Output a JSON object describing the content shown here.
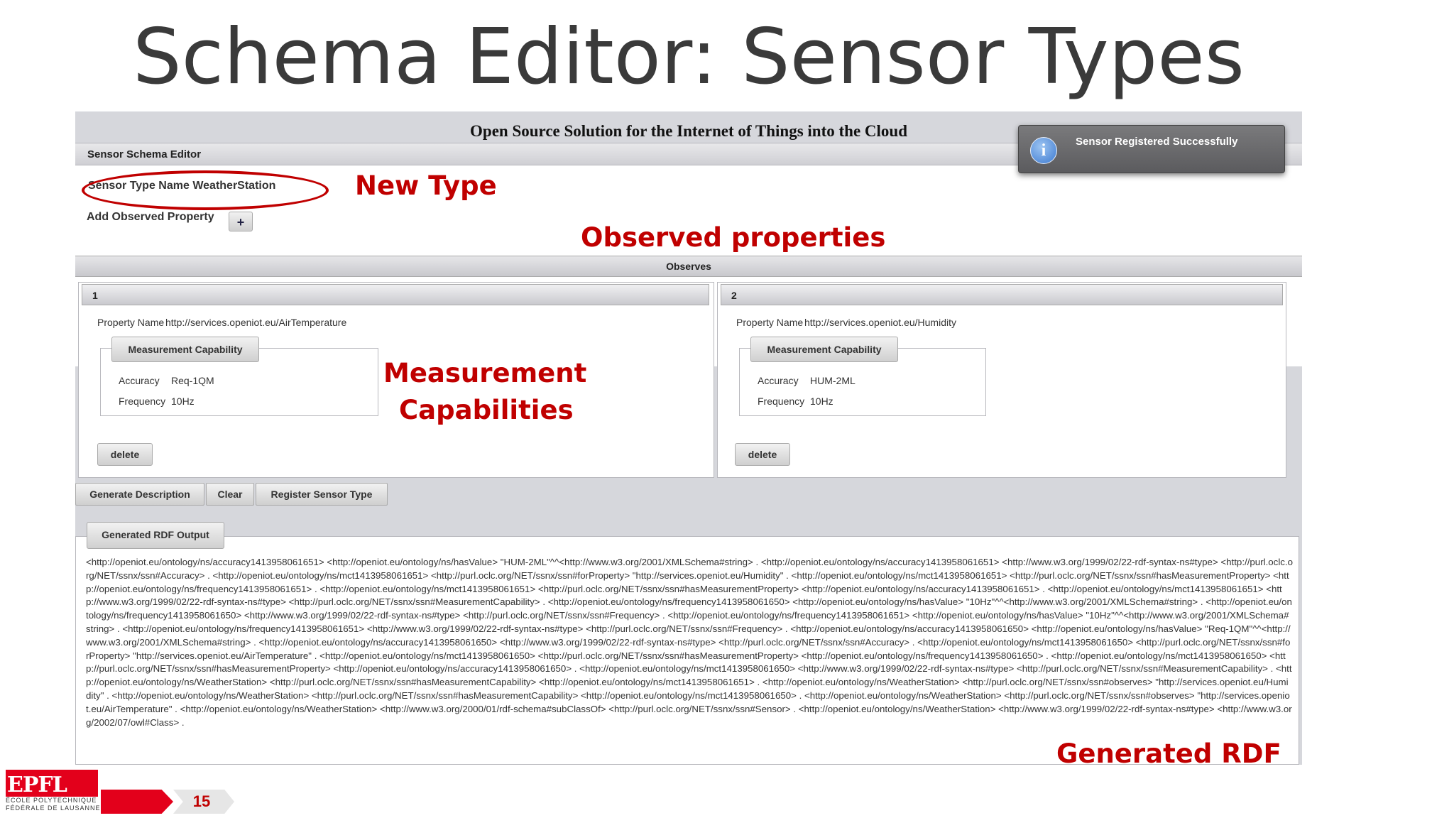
{
  "slide": {
    "title": "Schema Editor: Sensor Types",
    "page_number": "15"
  },
  "app": {
    "header": "Open Source Solution for the Internet of Things into the Cloud",
    "schema_editor": {
      "section_title": "Sensor Schema Editor",
      "type_name_label": "Sensor Type Name",
      "type_name_value": "WeatherStation",
      "add_property_label": "Add Observed Property",
      "add_button_glyph": "+"
    },
    "observes": {
      "title": "Observes",
      "properties": [
        {
          "index": "1",
          "property_name_label": "Property Name",
          "property_name_value": "http://services.openiot.eu/AirTemperature",
          "capability_title": "Measurement Capability",
          "accuracy_label": "Accuracy",
          "accuracy_value": "Req-1QM",
          "frequency_label": "Frequency",
          "frequency_value": "10Hz",
          "delete_label": "delete"
        },
        {
          "index": "2",
          "property_name_label": "Property Name",
          "property_name_value": "http://services.openiot.eu/Humidity",
          "capability_title": "Measurement Capability",
          "accuracy_label": "Accuracy",
          "accuracy_value": "HUM-2ML",
          "frequency_label": "Frequency",
          "frequency_value": "10Hz",
          "delete_label": "delete"
        }
      ]
    },
    "actions": {
      "generate_label": "Generate Description",
      "clear_label": "Clear",
      "register_label": "Register Sensor Type"
    },
    "rdf_output": {
      "title": "Generated RDF Output",
      "text": "<http://openiot.eu/ontology/ns/accuracy1413958061651> <http://openiot.eu/ontology/ns/hasValue> \"HUM-2ML\"^^<http://www.w3.org/2001/XMLSchema#string> . <http://openiot.eu/ontology/ns/accuracy1413958061651> <http://www.w3.org/1999/02/22-rdf-syntax-ns#type> <http://purl.oclc.org/NET/ssnx/ssn#Accuracy> . <http://openiot.eu/ontology/ns/mct1413958061651> <http://purl.oclc.org/NET/ssnx/ssn#forProperty> \"http://services.openiot.eu/Humidity\" . <http://openiot.eu/ontology/ns/mct1413958061651> <http://purl.oclc.org/NET/ssnx/ssn#hasMeasurementProperty> <http://openiot.eu/ontology/ns/frequency1413958061651> . <http://openiot.eu/ontology/ns/mct1413958061651> <http://purl.oclc.org/NET/ssnx/ssn#hasMeasurementProperty> <http://openiot.eu/ontology/ns/accuracy1413958061651> . <http://openiot.eu/ontology/ns/mct1413958061651> <http://www.w3.org/1999/02/22-rdf-syntax-ns#type> <http://purl.oclc.org/NET/ssnx/ssn#MeasurementCapability> . <http://openiot.eu/ontology/ns/frequency1413958061650> <http://openiot.eu/ontology/ns/hasValue> \"10Hz\"^^<http://www.w3.org/2001/XMLSchema#string> . <http://openiot.eu/ontology/ns/frequency1413958061650> <http://www.w3.org/1999/02/22-rdf-syntax-ns#type> <http://purl.oclc.org/NET/ssnx/ssn#Frequency> . <http://openiot.eu/ontology/ns/frequency1413958061651> <http://openiot.eu/ontology/ns/hasValue> \"10Hz\"^^<http://www.w3.org/2001/XMLSchema#string> . <http://openiot.eu/ontology/ns/frequency1413958061651> <http://www.w3.org/1999/02/22-rdf-syntax-ns#type> <http://purl.oclc.org/NET/ssnx/ssn#Frequency> . <http://openiot.eu/ontology/ns/accuracy1413958061650> <http://openiot.eu/ontology/ns/hasValue> \"Req-1QM\"^^<http://www.w3.org/2001/XMLSchema#string> . <http://openiot.eu/ontology/ns/accuracy1413958061650> <http://www.w3.org/1999/02/22-rdf-syntax-ns#type> <http://purl.oclc.org/NET/ssnx/ssn#Accuracy> . <http://openiot.eu/ontology/ns/mct1413958061650> <http://purl.oclc.org/NET/ssnx/ssn#forProperty> \"http://services.openiot.eu/AirTemperature\" . <http://openiot.eu/ontology/ns/mct1413958061650> <http://purl.oclc.org/NET/ssnx/ssn#hasMeasurementProperty> <http://openiot.eu/ontology/ns/frequency1413958061650> . <http://openiot.eu/ontology/ns/mct1413958061650> <http://purl.oclc.org/NET/ssnx/ssn#hasMeasurementProperty> <http://openiot.eu/ontology/ns/accuracy1413958061650> . <http://openiot.eu/ontology/ns/mct1413958061650> <http://www.w3.org/1999/02/22-rdf-syntax-ns#type> <http://purl.oclc.org/NET/ssnx/ssn#MeasurementCapability> . <http://openiot.eu/ontology/ns/WeatherStation> <http://purl.oclc.org/NET/ssnx/ssn#hasMeasurementCapability> <http://openiot.eu/ontology/ns/mct1413958061651> . <http://openiot.eu/ontology/ns/WeatherStation> <http://purl.oclc.org/NET/ssnx/ssn#observes> \"http://services.openiot.eu/Humidity\" . <http://openiot.eu/ontology/ns/WeatherStation> <http://purl.oclc.org/NET/ssnx/ssn#hasMeasurementCapability> <http://openiot.eu/ontology/ns/mct1413958061650> . <http://openiot.eu/ontology/ns/WeatherStation> <http://purl.oclc.org/NET/ssnx/ssn#observes> \"http://services.openiot.eu/AirTemperature\" . <http://openiot.eu/ontology/ns/WeatherStation> <http://www.w3.org/2000/01/rdf-schema#subClassOf> <http://purl.oclc.org/NET/ssnx/ssn#Sensor> . <http://openiot.eu/ontology/ns/WeatherStation> <http://www.w3.org/1999/02/22-rdf-syntax-ns#type> <http://www.w3.org/2002/07/owl#Class> ."
    },
    "notification": {
      "text": "Sensor Registered Successfully",
      "icon": "info-icon",
      "icon_glyph": "i"
    }
  },
  "annotations": {
    "new_type": "New Type",
    "observed_properties": "Observed properties",
    "measurement_line1": "Measurement",
    "measurement_line2": "Capabilities",
    "generated_rdf": "Generated RDF",
    "color": "#c00000"
  },
  "logo": {
    "mark": "EPFL",
    "line1": "ÉCOLE POLYTECHNIQUE",
    "line2": "FÉDÉRALE DE LAUSANNE",
    "color": "#e3001b"
  }
}
